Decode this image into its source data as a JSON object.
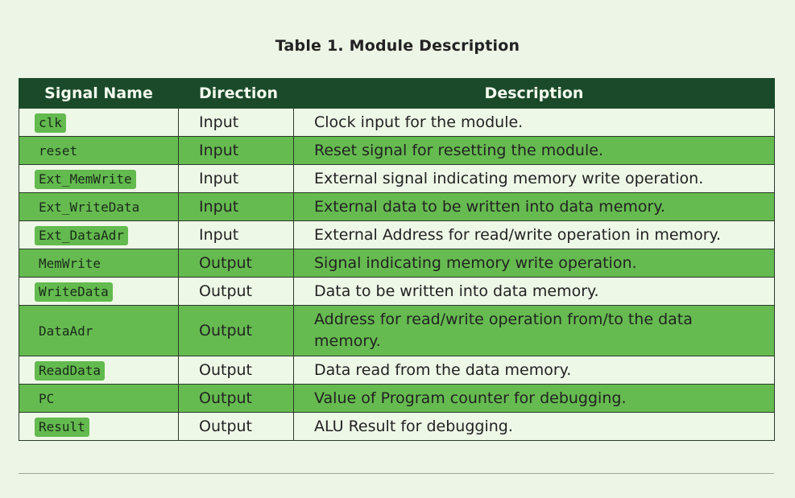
{
  "caption": "Table 1. Module Description",
  "headers": {
    "name": "Signal Name",
    "direction": "Direction",
    "description": "Description"
  },
  "rows": [
    {
      "name": "clk",
      "direction": "Input",
      "description": "Clock input for the module."
    },
    {
      "name": "reset",
      "direction": "Input",
      "description": "Reset signal for resetting the module."
    },
    {
      "name": "Ext_MemWrite",
      "direction": "Input",
      "description": "External signal indicating memory write operation."
    },
    {
      "name": "Ext_WriteData",
      "direction": "Input",
      "description": "External data to be written into data memory."
    },
    {
      "name": "Ext_DataAdr",
      "direction": "Input",
      "description": "External Address for read/write operation in memory."
    },
    {
      "name": "MemWrite",
      "direction": "Output",
      "description": "Signal indicating memory write operation."
    },
    {
      "name": "WriteData",
      "direction": "Output",
      "description": "Data to be written into data memory."
    },
    {
      "name": "DataAdr",
      "direction": "Output",
      "description": "Address for read/write operation from/to the data memory."
    },
    {
      "name": "ReadData",
      "direction": "Output",
      "description": "Data read from the data memory."
    },
    {
      "name": "PC",
      "direction": "Output",
      "description": "Value of Program counter for debugging."
    },
    {
      "name": "Result",
      "direction": "Output",
      "description": "ALU Result for debugging."
    }
  ],
  "colors": {
    "page_background": "#edf6e6",
    "header_background": "#1a4a2a",
    "row_light": "#eef8e7",
    "row_green": "#66bb50"
  }
}
